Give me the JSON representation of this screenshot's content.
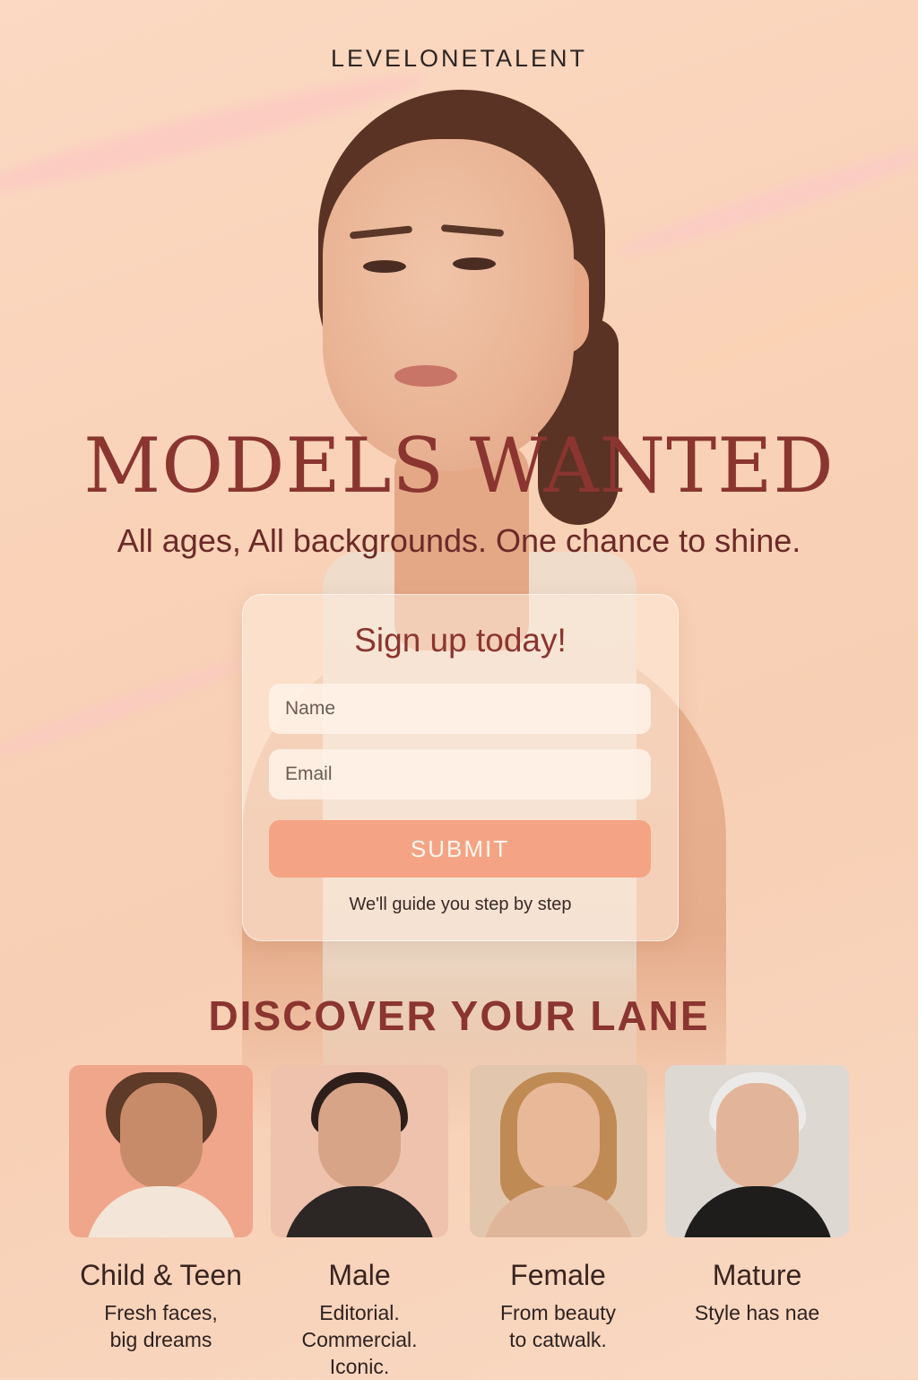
{
  "brand": "LEVELONETALENT",
  "hero": {
    "headline": "MODELS WANTED",
    "subhead": "All ages, All backgrounds. One chance to shine."
  },
  "form": {
    "title": "Sign up today!",
    "name_placeholder": "Name",
    "email_placeholder": "Email",
    "submit_label": "SUBMIT",
    "note": "We'll guide you step by step"
  },
  "lanes": {
    "title": "DISCOVER YOUR LANE",
    "items": [
      {
        "title": "Child & Teen",
        "description": "Fresh faces,\nbig dreams"
      },
      {
        "title": "Male",
        "description": "Editorial.\nCommercial.\nIconic."
      },
      {
        "title": "Female",
        "description": "From beauty\nto catwalk."
      },
      {
        "title": "Mature",
        "description": "Style has nae"
      }
    ]
  },
  "colors": {
    "accent": "#8b3530",
    "button": "#f4a484",
    "background": "#f9d2b8"
  }
}
